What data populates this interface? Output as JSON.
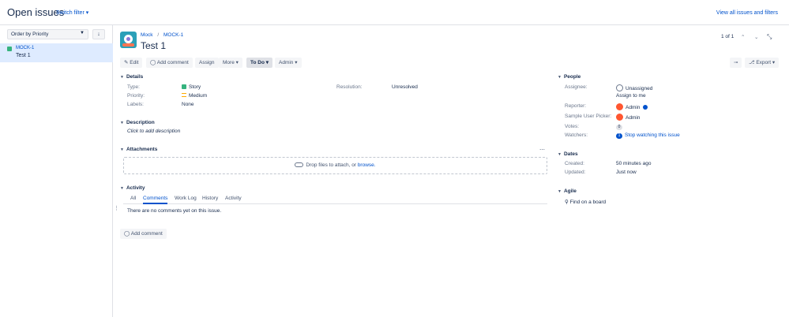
{
  "header": {
    "title": "Open issues",
    "switch_filter": "Switch filter",
    "view_all": "View all issues and filters"
  },
  "list": {
    "order_by": "Order by Priority",
    "sort_icon": "arrow-down-icon",
    "items": [
      {
        "key": "MOCK-1",
        "summary": "Test 1"
      }
    ]
  },
  "issue": {
    "breadcrumb": {
      "project": "Mock",
      "separator": "/",
      "key": "MOCK-1"
    },
    "title": "Test 1",
    "pager": "1 of 1"
  },
  "toolbar": {
    "edit": "Edit",
    "add_comment": "Add comment",
    "assign": "Assign",
    "more": "More",
    "status": "To Do",
    "admin": "Admin",
    "export": "Export"
  },
  "details": {
    "heading": "Details",
    "type_label": "Type:",
    "type_value": "Story",
    "priority_label": "Priority:",
    "priority_value": "Medium",
    "labels_label": "Labels:",
    "labels_value": "None",
    "resolution_label": "Resolution:",
    "resolution_value": "Unresolved"
  },
  "description": {
    "heading": "Description",
    "placeholder": "Click to add description"
  },
  "attachments": {
    "heading": "Attachments",
    "drop_text": "Drop files to attach, or",
    "browse": "browse."
  },
  "activity": {
    "heading": "Activity",
    "tabs": [
      "All",
      "Comments",
      "Work Log",
      "History",
      "Activity"
    ],
    "active_tab": "Comments",
    "empty": "There are no comments yet on this issue.",
    "add_comment": "Add comment"
  },
  "people": {
    "heading": "People",
    "assignee_label": "Assignee:",
    "assignee_value": "Unassigned",
    "assign_to_me": "Assign to me",
    "reporter_label": "Reporter:",
    "reporter_value": "Admin",
    "sample_label": "Sample User Picker:",
    "sample_value": "Admin",
    "votes_label": "Votes:",
    "votes_value": "0",
    "watchers_label": "Watchers:",
    "watchers_count": "1",
    "watchers_link": "Stop watching this issue"
  },
  "dates": {
    "heading": "Dates",
    "created_label": "Created:",
    "created_value": "50 minutes ago",
    "updated_label": "Updated:",
    "updated_value": "Just now"
  },
  "agile": {
    "heading": "Agile",
    "find_board": "Find on a board"
  },
  "colors": {
    "link": "#0052cc",
    "selected_bg": "#deebff",
    "story": "#36b37e",
    "priority_medium": "#ffab00"
  }
}
